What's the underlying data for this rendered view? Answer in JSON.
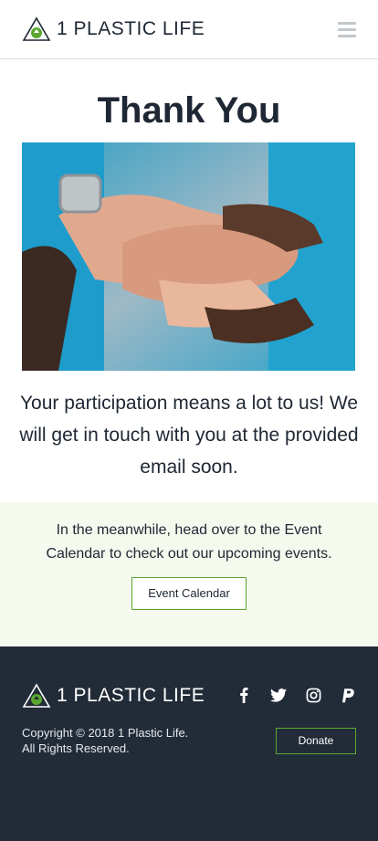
{
  "header": {
    "logo_text": "1 PLASTIC LIFE",
    "menu_icon": "hamburger-menu-icon"
  },
  "main": {
    "title": "Thank You",
    "message": "Your participation means a lot to us! We will get in touch with you at the provided email soon."
  },
  "cta": {
    "text": "In the meanwhile, head over to the Event Calendar to check out our upcoming events.",
    "button_label": "Event Calendar"
  },
  "footer": {
    "logo_text": "1 PLASTIC LIFE",
    "copyright_line1": "Copyright © 2018 1 Plastic Life.",
    "copyright_line2": "All Rights Reserved.",
    "donate_label": "Donate",
    "social": [
      "facebook-icon",
      "twitter-icon",
      "instagram-icon",
      "paypal-icon"
    ]
  },
  "colors": {
    "accent_green": "#5aa832",
    "footer_bg": "#222b38",
    "cta_bg": "#f6f9ee",
    "text_dark": "#1e2733"
  }
}
